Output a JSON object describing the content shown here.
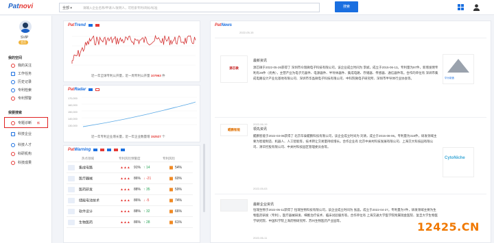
{
  "header": {
    "logo_main": "Pat",
    "logo_accent": "novi",
    "search_select": "全部",
    "search_placeholder": "请输入企业名称/申请人/发明人，可检索专利/商标/标准",
    "search_button": "搜索"
  },
  "sidebar": {
    "username": "SVIP",
    "vip_badge": "会员",
    "section1": "我的空间",
    "items1": [
      "我的关注",
      "工作任务",
      "历史记录",
      "专利检索",
      "专利预警"
    ],
    "section2": "我要搜索",
    "items2": [
      "专题诊断",
      "科技企业",
      "科技人才",
      "科研机构",
      "科技成果"
    ],
    "new_badge": "新",
    "icon_colors": [
      "#e53935",
      "#1a6fe0",
      "#1a6fe0",
      "#1a6fe0",
      "#e53935",
      "#1a6fe0",
      "#1a6fe0",
      "#e53935",
      "#e53935",
      "#1a6fe0"
    ]
  },
  "trend": {
    "title_a": "Pat",
    "title_b": "Trend",
    "caption_prefix": "近一年全球专利公开量，近一周专利公开量",
    "caption_value": "107963",
    "caption_suffix": "件"
  },
  "radar": {
    "title_a": "Pat",
    "title_b": "Radar",
    "yticks": [
      "170,000",
      "160,000",
      "150,000",
      "140,000",
      "130,000"
    ],
    "caption_prefix": "近一年专利企业增长量，近一年企业数量增",
    "caption_value": "152527",
    "caption_suffix": "个"
  },
  "warning": {
    "title_a": "Pat",
    "title_b": "Warning",
    "headers": [
      "热点领域",
      "专利风险预警度",
      "专利风险"
    ],
    "rows": [
      {
        "name": "集成电路",
        "pct": "91%",
        "delta": "14",
        "risk": "54%"
      },
      {
        "name": "医疗器械",
        "pct": "86%",
        "delta": "-21",
        "risk": "60%"
      },
      {
        "name": "医药研发",
        "pct": "88%",
        "delta": "35",
        "risk": "59%"
      },
      {
        "name": "储能电池技术",
        "pct": "86%",
        "delta": "-5",
        "risk": "74%"
      },
      {
        "name": "软件设计",
        "pct": "88%",
        "delta": "32",
        "risk": "66%"
      },
      {
        "name": "生物医药",
        "pct": "86%",
        "delta": "28",
        "risk": "61%"
      }
    ]
  },
  "news": {
    "title_a": "Pat",
    "title_b": "News",
    "top_date": "2022-05-15",
    "items": [
      {
        "logo": "源芯微",
        "title": "最新资讯",
        "text": "源芯微于2022-05-26获得了 深圳市众瑞微电子科技有限公司，该企业成立时间为 李斌，成立于2015-06-13。专利量为97件，新增发明专利有29件（优秀），主营产业为电子元器件、电源器件、半导体器件、集成电路、存储器、传感器、通信器件等。合作的单位有 深圳市集成电路设计产业化基地有限公司、深圳市华晶微电子科技有限公司、中科院微电子研究所、深圳市半导体行业协会等。",
        "date": "2022-06-19",
        "ad": "华为制造"
      },
      {
        "logo": "鲲鹏智能",
        "title": "领先资讯",
        "text": "鲲鹏智能于2022-03-06获得了 北京华泰鲲鹏科技有限公司，该企业成立时间为 刘清，成立于2015-08-06。专利量为318件，研发领域主要为智能制造、机器人、人工智能等，技术转让交易量持续增长。合作企业有 北京中关村科技发展有限公司、上海交大科技园有限公司、清华控股有限公司、中关村科技园区管理委员会等。",
        "date": "2022-05-03",
        "ad": "CytoNiche"
      },
      {
        "logo": "",
        "title": "最新企业资讯",
        "text": "恒瑞生物于2022-05-11获得了 恒瑞生物科技有限公司，该企业成立时间为 张晶，成立于2022-04-27。专利量为7件，研发领域主要为生物医药研发（专利），医疗器械研发、细胞治疗技术、临床试验服务等。合作单位有 上海交通大学医学院附属瑞金医院、复旦大学生物医学研究院、中国科学院上海药物研究所、苏州生物医药产业园等。",
        "date": "2022-06-11",
        "ad": ""
      }
    ]
  },
  "watermark": "12425.CN"
}
